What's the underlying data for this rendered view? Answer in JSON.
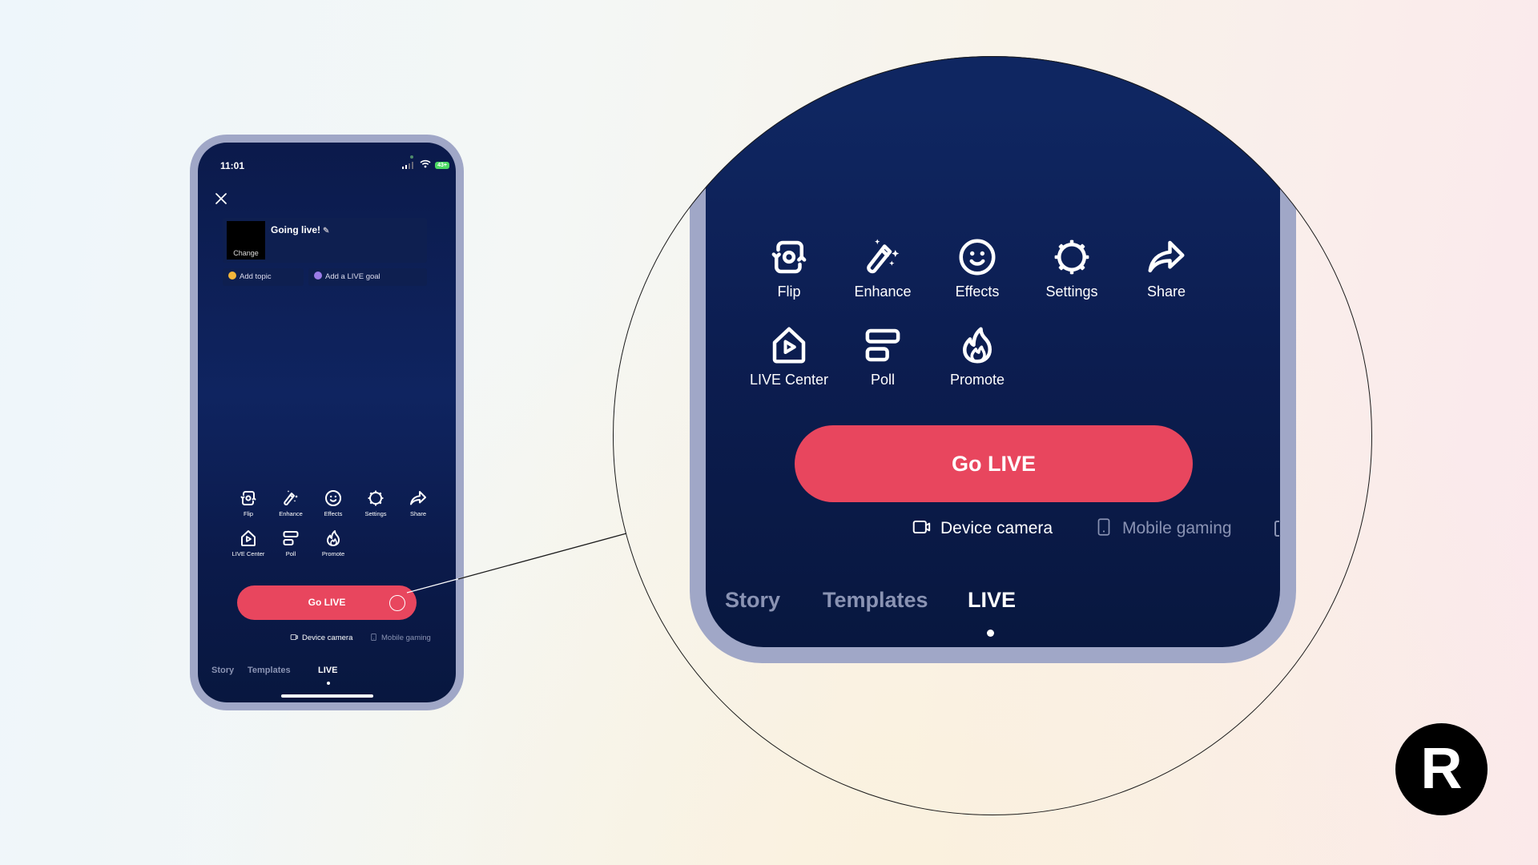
{
  "status_bar": {
    "time": "11:01",
    "battery": "43+"
  },
  "stream": {
    "title": "Going live!",
    "thumbnail_change_label": "Change",
    "add_topic_label": "Add topic",
    "add_goal_label": "Add a LIVE goal"
  },
  "tools": [
    {
      "label": "Flip",
      "icon": "flip-camera-icon"
    },
    {
      "label": "Enhance",
      "icon": "magic-wand-icon"
    },
    {
      "label": "Effects",
      "icon": "smiley-face-icon"
    },
    {
      "label": "Settings",
      "icon": "gear-icon"
    },
    {
      "label": "Share",
      "icon": "share-arrow-icon"
    },
    {
      "label": "LIVE Center",
      "icon": "live-center-home-icon"
    },
    {
      "label": "Poll",
      "icon": "poll-icon"
    },
    {
      "label": "Promote",
      "icon": "flame-icon"
    }
  ],
  "go_live_label": "Go LIVE",
  "source_modes": [
    {
      "label": "Device camera",
      "active": true
    },
    {
      "label": "Mobile gaming",
      "active": false
    }
  ],
  "bottom_tabs": [
    {
      "label": "Story",
      "active": false
    },
    {
      "label": "Templates",
      "active": false
    },
    {
      "label": "LIVE",
      "active": true
    }
  ],
  "brand_badge": "R",
  "colors": {
    "accent": "#e8465e",
    "screen_bg": "#0f2460",
    "bezel": "#a0a7c7"
  }
}
